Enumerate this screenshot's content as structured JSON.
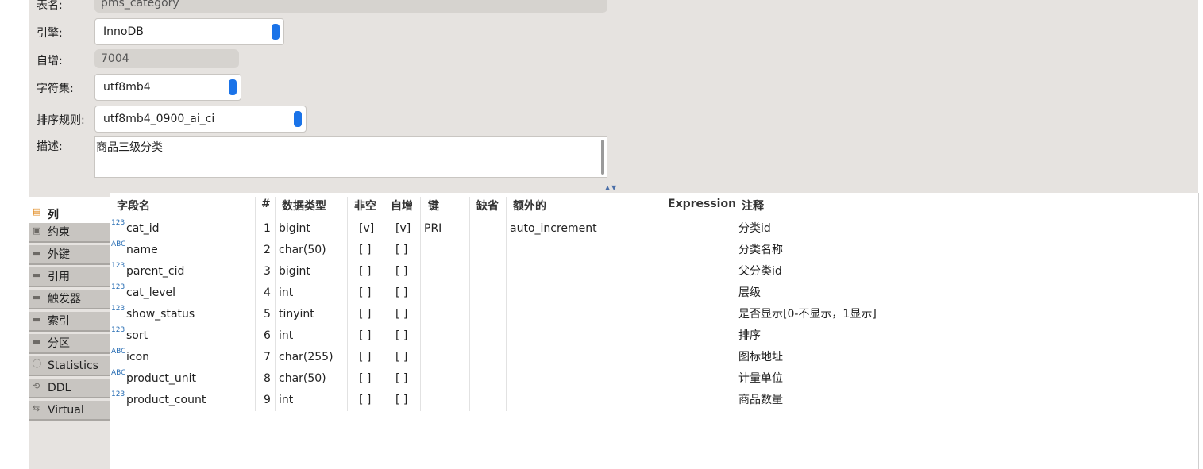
{
  "form": {
    "table_name_label": "表名:",
    "table_name_value": "pms_category",
    "engine_label": "引擎:",
    "engine_value": "InnoDB",
    "auto_inc_label": "自增:",
    "auto_inc_value": "7004",
    "charset_label": "字符集:",
    "charset_value": "utf8mb4",
    "collation_label": "排序规则:",
    "collation_value": "utf8mb4_0900_ai_ci",
    "desc_label": "描述:",
    "desc_value": "商品三级分类"
  },
  "tabs": [
    {
      "label": "列",
      "icon": "columns-icon"
    },
    {
      "label": "约束",
      "icon": "constraint-icon"
    },
    {
      "label": "外键",
      "icon": "folder-icon"
    },
    {
      "label": "引用",
      "icon": "folder-icon"
    },
    {
      "label": "触发器",
      "icon": "folder-icon"
    },
    {
      "label": "索引",
      "icon": "folder-icon"
    },
    {
      "label": "分区",
      "icon": "folder-icon"
    },
    {
      "label": "Statistics",
      "icon": "info-icon"
    },
    {
      "label": "DDL",
      "icon": "ddl-icon"
    },
    {
      "label": "Virtual",
      "icon": "virtual-icon"
    }
  ],
  "columns": {
    "headers": [
      "字段名",
      "#",
      "数据类型",
      "非空",
      "自增",
      "键",
      "缺省",
      "额外的",
      "Expression",
      "注释"
    ],
    "rows": [
      {
        "type_icon": "123",
        "name": "cat_id",
        "num": "1",
        "dtype": "bigint",
        "notnull": "[v]",
        "autoinc": "[v]",
        "key": "PRI",
        "default": "",
        "extra": "auto_increment",
        "expr": "",
        "comment": "分类id"
      },
      {
        "type_icon": "ABC",
        "name": "name",
        "num": "2",
        "dtype": "char(50)",
        "notnull": "[ ]",
        "autoinc": "[ ]",
        "key": "",
        "default": "",
        "extra": "",
        "expr": "",
        "comment": "分类名称"
      },
      {
        "type_icon": "123",
        "name": "parent_cid",
        "num": "3",
        "dtype": "bigint",
        "notnull": "[ ]",
        "autoinc": "[ ]",
        "key": "",
        "default": "",
        "extra": "",
        "expr": "",
        "comment": "父分类id"
      },
      {
        "type_icon": "123",
        "name": "cat_level",
        "num": "4",
        "dtype": "int",
        "notnull": "[ ]",
        "autoinc": "[ ]",
        "key": "",
        "default": "",
        "extra": "",
        "expr": "",
        "comment": "层级"
      },
      {
        "type_icon": "123",
        "name": "show_status",
        "num": "5",
        "dtype": "tinyint",
        "notnull": "[ ]",
        "autoinc": "[ ]",
        "key": "",
        "default": "",
        "extra": "",
        "expr": "",
        "comment": "是否显示[0-不显示，1显示]"
      },
      {
        "type_icon": "123",
        "name": "sort",
        "num": "6",
        "dtype": "int",
        "notnull": "[ ]",
        "autoinc": "[ ]",
        "key": "",
        "default": "",
        "extra": "",
        "expr": "",
        "comment": "排序"
      },
      {
        "type_icon": "ABC",
        "name": "icon",
        "num": "7",
        "dtype": "char(255)",
        "notnull": "[ ]",
        "autoinc": "[ ]",
        "key": "",
        "default": "",
        "extra": "",
        "expr": "",
        "comment": "图标地址"
      },
      {
        "type_icon": "ABC",
        "name": "product_unit",
        "num": "8",
        "dtype": "char(50)",
        "notnull": "[ ]",
        "autoinc": "[ ]",
        "key": "",
        "default": "",
        "extra": "",
        "expr": "",
        "comment": "计量单位"
      },
      {
        "type_icon": "123",
        "name": "product_count",
        "num": "9",
        "dtype": "int",
        "notnull": "[ ]",
        "autoinc": "[ ]",
        "key": "",
        "default": "",
        "extra": "",
        "expr": "",
        "comment": "商品数量"
      }
    ]
  }
}
